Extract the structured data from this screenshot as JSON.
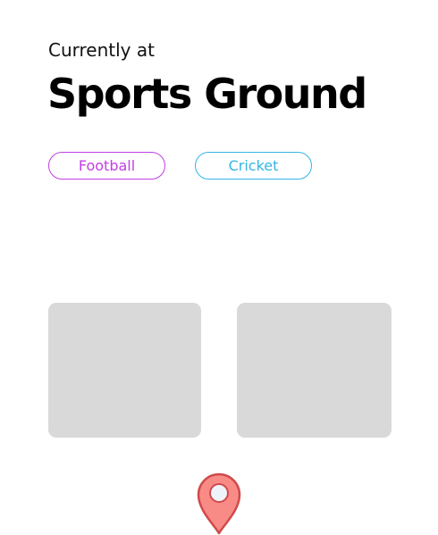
{
  "location": {
    "label": "Currently at",
    "name": "Sports Ground"
  },
  "tags": [
    {
      "label": "Football",
      "color": "#c23ee6"
    },
    {
      "label": "Cricket",
      "color": "#34b4e6"
    }
  ],
  "map_pin": {
    "icon": "location-pin-icon",
    "fill": "#f98b87",
    "stroke": "#cf4a4a"
  }
}
